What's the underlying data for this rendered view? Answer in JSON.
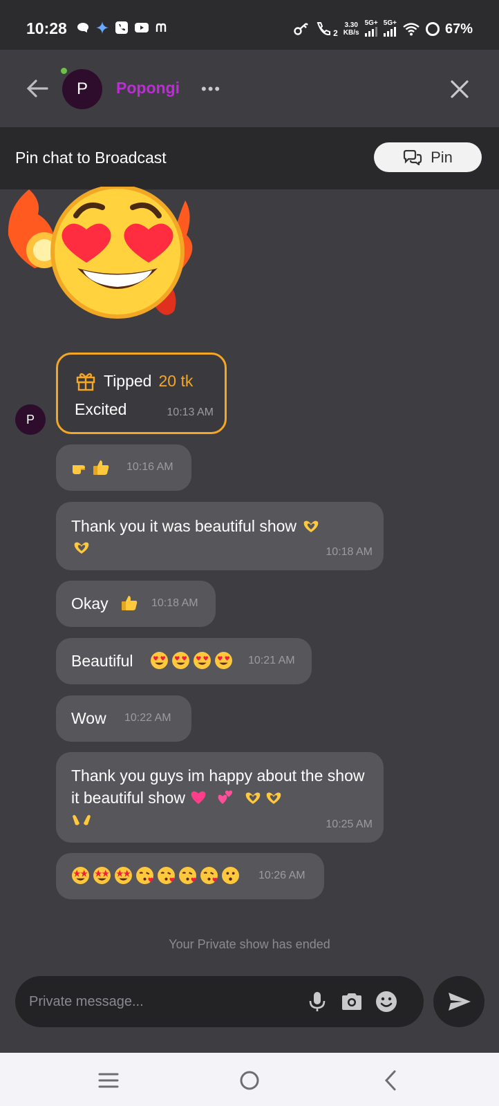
{
  "status_bar": {
    "time": "10:28",
    "data_speed": "3.30",
    "data_unit": "KB/s",
    "sim1_label": "5G+",
    "sim2_label": "5G+",
    "call_sim": "2",
    "battery": "67%",
    "notif_icons": [
      "chat-bubble-icon",
      "gemini-icon",
      "phone-app-icon",
      "youtube-icon",
      "m-icon"
    ]
  },
  "header": {
    "avatar_letter": "P",
    "username": "Popongi",
    "more_label": "•••"
  },
  "pin_banner": {
    "text": "Pin chat to Broadcast",
    "button_label": "Pin"
  },
  "sender_avatar_letter": "P",
  "tip": {
    "label": "Tipped",
    "amount": "20 tk",
    "note": "Excited",
    "time": "10:13 AM"
  },
  "messages": [
    {
      "text": "",
      "time": "10:16 AM",
      "emoji": [
        "point-right",
        "thumbs-up"
      ]
    },
    {
      "text": "Thank you it was beautiful show",
      "time": "10:18 AM",
      "emoji": [
        "heart-hands",
        "heart-hands"
      ]
    },
    {
      "text": "Okay",
      "time": "10:18 AM",
      "emoji": [
        "thumbs-up"
      ]
    },
    {
      "text": "Beautiful",
      "time": "10:21 AM",
      "emoji": [
        "heart-eyes",
        "heart-eyes",
        "heart-eyes",
        "heart-eyes"
      ]
    },
    {
      "text": "Wow",
      "time": "10:22 AM",
      "emoji": []
    },
    {
      "text": "Thank you guys im happy about the show it beautiful show",
      "time": "10:25 AM",
      "emoji": [
        "growing-heart",
        "two-hearts",
        "heart-hands",
        "heart-hands",
        "open-hands"
      ]
    },
    {
      "text": "",
      "time": "10:26 AM",
      "emoji": [
        "star-struck",
        "star-struck",
        "star-struck",
        "kissing-heart",
        "kissing-heart",
        "kissing-heart",
        "kissing-heart",
        "kissing"
      ]
    }
  ],
  "system_message": "Your Private show has ended",
  "composer": {
    "placeholder": "Private message..."
  },
  "colors": {
    "background": "#3e3e42",
    "bubble": "#57575b",
    "username": "#c02ad8",
    "tip_accent": "#f5a623"
  }
}
